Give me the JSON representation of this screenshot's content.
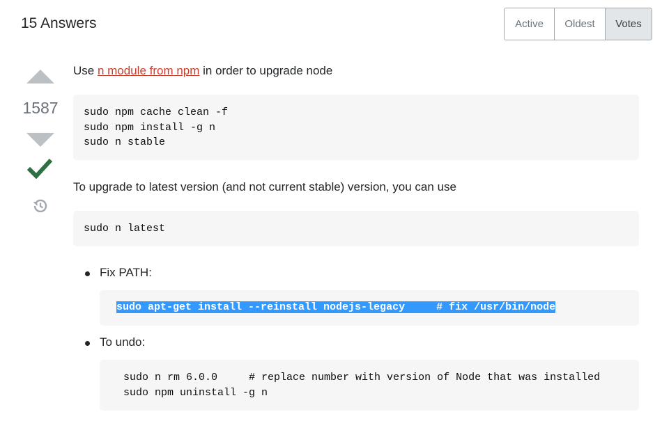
{
  "header": {
    "title": "15 Answers"
  },
  "sort_tabs": [
    {
      "label": "Active",
      "selected": false
    },
    {
      "label": "Oldest",
      "selected": false
    },
    {
      "label": "Votes",
      "selected": true
    }
  ],
  "vote": {
    "count": "1587",
    "accepted": true
  },
  "answer": {
    "intro": {
      "before": "Use ",
      "link_text": "n module from npm",
      "after": " in order to upgrade node"
    },
    "code_block_1": [
      "sudo npm cache clean -f",
      "sudo npm install -g n",
      "sudo n stable"
    ],
    "paragraph_2": "To upgrade to latest version (and not current stable) version, you can use",
    "code_block_2": [
      "sudo n latest"
    ],
    "list": [
      {
        "label": "Fix PATH:",
        "code": [
          "sudo apt-get install --reinstall nodejs-legacy     # fix /usr/bin/node"
        ]
      },
      {
        "label": "To undo:",
        "code": [
          "sudo n rm 6.0.0     # replace number with version of Node that was installed",
          "sudo npm uninstall -g n"
        ]
      }
    ]
  },
  "colors": {
    "link": "#c5402f",
    "accepted": "#2f6f44",
    "selection": "#3399ff",
    "vote_arrow": "#bbc0c4"
  },
  "icons": {
    "upvote": "triangle-up-icon",
    "downvote": "triangle-down-icon",
    "accepted": "checkmark-icon",
    "history": "history-icon"
  }
}
